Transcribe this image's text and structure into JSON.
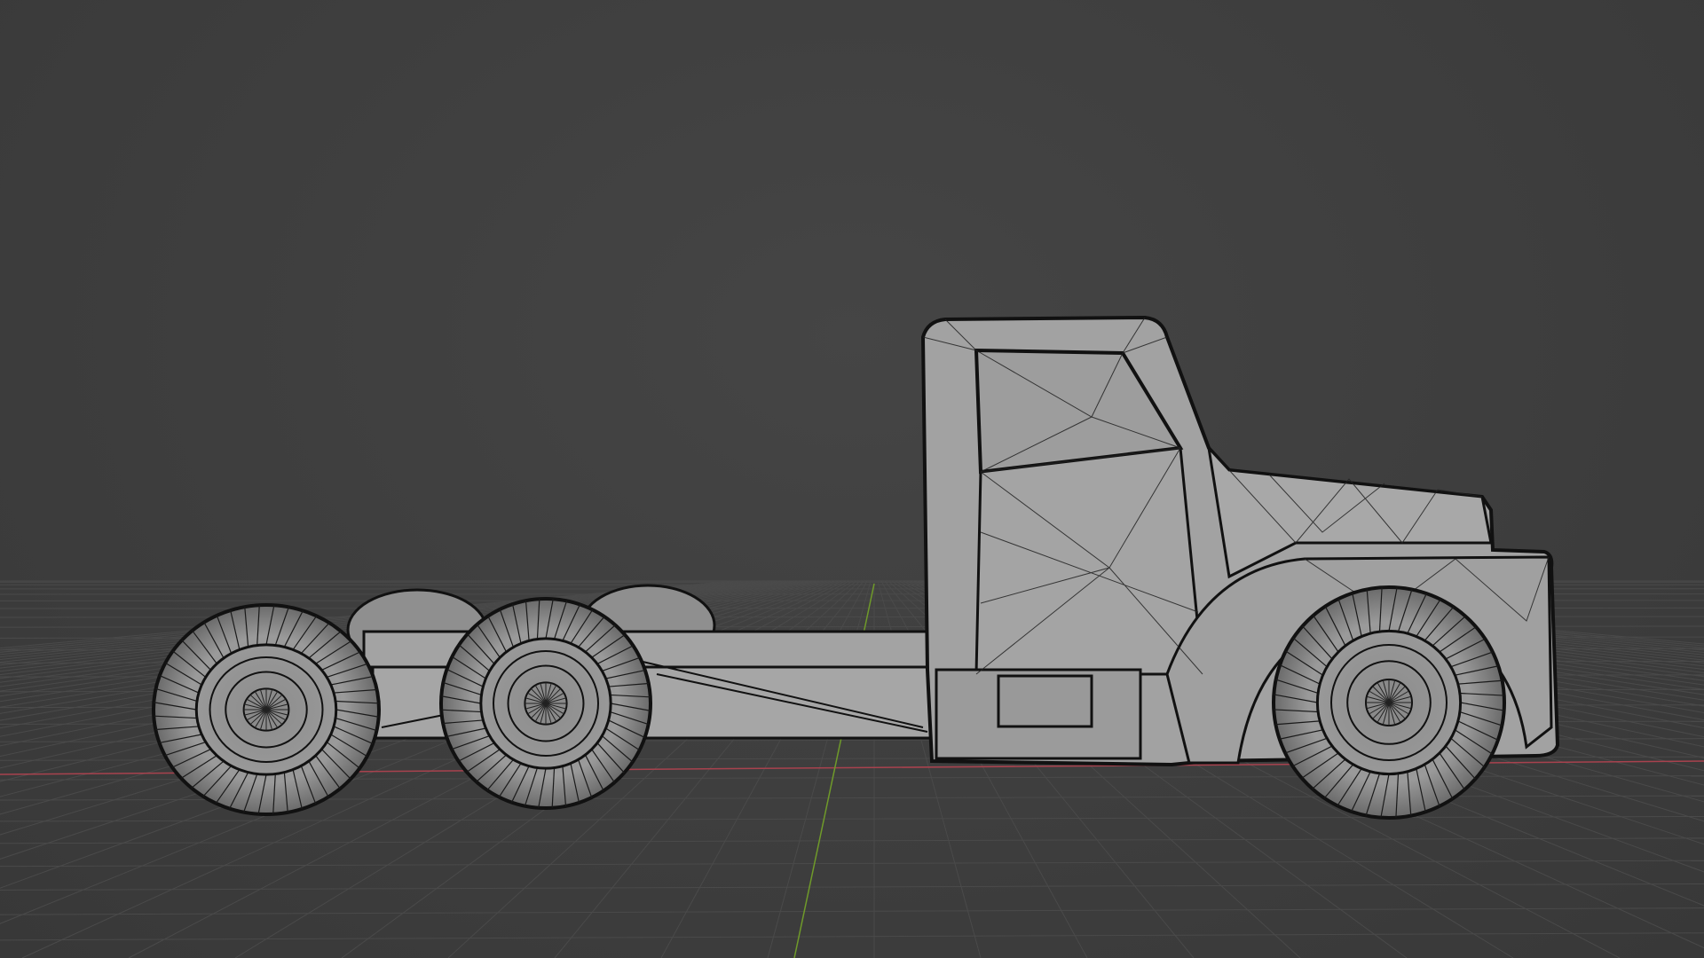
{
  "viewport": {
    "background_color": "#3d3d3d",
    "grid_color": "#4a4a4a",
    "x_axis_color": "#a8424e",
    "y_axis_color": "#6f9a2a",
    "mesh_fill_color": "#9e9e9e",
    "wire_color": "#111111",
    "shading_mode": "wireframe-overlay",
    "object": "truck-tractor-mesh"
  }
}
